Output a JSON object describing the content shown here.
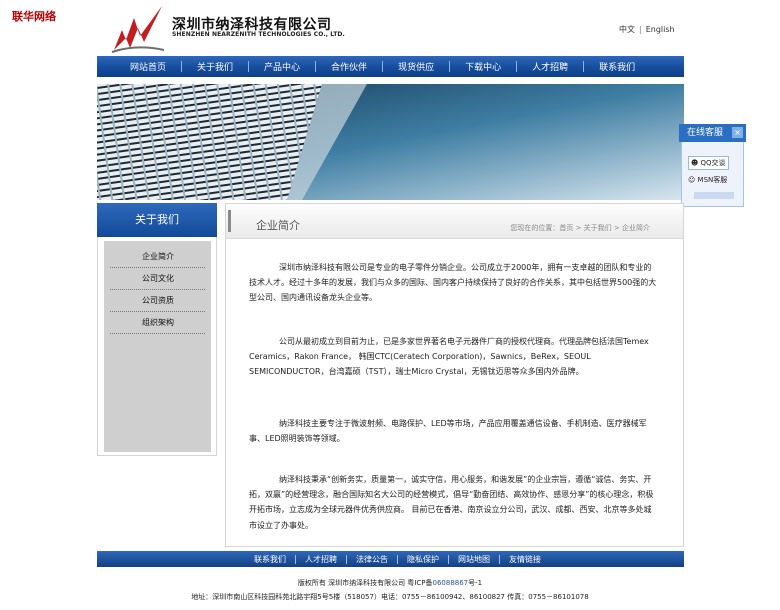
{
  "corner_label": "联华网络",
  "company": {
    "name_cn": "深圳市纳泽科技有限公司",
    "name_en": "SHENZHEN NEARZENITH TECHNOLOGIES CO., LTD."
  },
  "lang": {
    "zh": "中文",
    "en": "English"
  },
  "nav": [
    "网站首页",
    "关于我们",
    "产品中心",
    "合作伙伴",
    "现货供应",
    "下载中心",
    "人才招聘",
    "联系我们"
  ],
  "float_service": {
    "title": "在线客服",
    "close": "×",
    "qq": "QQ交谈",
    "msn": "MSN客服"
  },
  "sidebar": {
    "title": "关于我们",
    "items": [
      "企业简介",
      "公司文化",
      "公司资质",
      "组织架构"
    ]
  },
  "main": {
    "title": "企业简介",
    "breadcrumb": "您现在的位置：首页 > 关于我们 > 企业简介",
    "paragraphs": [
      "深圳市纳泽科技有限公司是专业的电子零件分销企业。公司成立于2000年，拥有一支卓越的团队和专业的技术人才。经过十多年的发展，我们与众多的国际、国内客户持续保持了良好的合作关系，其中包括世界500强的大型公司、国内通讯设备龙头企业等。",
      "公司从最初成立到目前为止，已是多家世界著名电子元器件厂商的授权代理商。代理品牌包括法国Temex Ceramics，Rakon France， 韩国CTC(Ceratech Corporation)，Sawnics，BeRex，SEOUL SEMICONDUCTOR，台湾嘉硕（TST），瑞士Micro Crystal，无锡钛迈思等众多国内外品牌。",
      "纳泽科技主要专注于微波射频、电路保护、LED等市场，产品应用覆盖通信设备、手机制造、医疗器械军事、LED照明装饰等领域。",
      "纳泽科技秉承“创新务实，质量第一，诚实守信，用心服务，和谐发展”的企业宗旨，遵循“诚信、务实、开拓，双赢”的经营理念，融合国际知名大公司的经营模式，倡导“勤奋团结、高效协作、感恩分享”的核心理念，积极开拓市场，立志成为全球元器件优秀供应商。 目前已在香港、南京设立分公司，武汉、成都、西安、北京等多处城市设立了办事处。"
    ]
  },
  "footer": {
    "links": [
      "联系我们",
      "人才招聘",
      "法律公告",
      "隐私保护",
      "网站地图",
      "友情链接"
    ],
    "copyright": "版权所有  深圳市纳泽科技有限公司  粤",
    "icp_label": "ICP备",
    "icp_number": "06088867",
    "icp_suffix": "号-1",
    "address": "地址：深圳市南山区科技园科苑北路宇翔5号5楼（518057）电话：0755－86100942、86100827 传真：0755－86101078"
  },
  "colors": {
    "nav_blue": "#164d9d",
    "corner_red": "#c00000",
    "icp_blue": "#2451a8"
  }
}
